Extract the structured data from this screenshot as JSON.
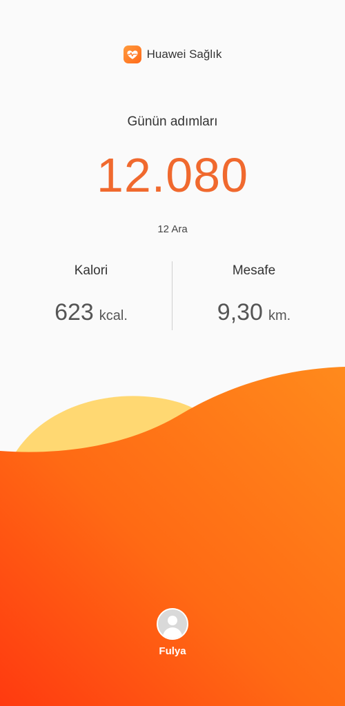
{
  "header": {
    "app_name": "Huawei Sağlık",
    "icon": "heart-pulse-icon"
  },
  "steps": {
    "label": "Günün adımları",
    "value": "12.080",
    "date": "12 Ara"
  },
  "stats": {
    "calories": {
      "label": "Kalori",
      "value": "623",
      "unit": "kcal."
    },
    "distance": {
      "label": "Mesafe",
      "value": "9,30",
      "unit": "km."
    }
  },
  "profile": {
    "name": "Fulya",
    "icon": "avatar-icon"
  },
  "colors": {
    "accent": "#f0692e",
    "wave_light": "#ffd56b",
    "wave_orange": "#ff7a1a",
    "wave_red": "#ff3d0f"
  }
}
